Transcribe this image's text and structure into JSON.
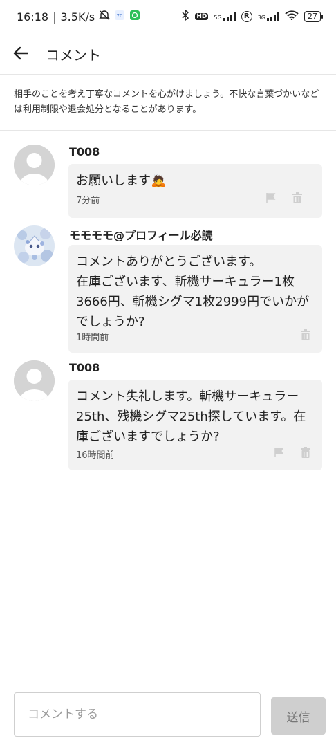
{
  "status_bar": {
    "time": "16:18",
    "network_speed": "3.5K/s",
    "network_type_1": "5G",
    "network_type_2": "3G",
    "battery": "27",
    "hd_label": "HD",
    "roaming_label": "R"
  },
  "header": {
    "title": "コメント",
    "back_icon": "arrow-left-icon"
  },
  "notice": {
    "text": "相手のことを考え丁寧なコメントを心がけましょう。不快な言葉づかいなどは利用制限や退会処分となることがあります。"
  },
  "comments": [
    {
      "user": "T008",
      "avatar": "default-avatar",
      "text": "お願いします🙇",
      "time": "7分前",
      "show_flag": true
    },
    {
      "user": "モモモモ@プロフィール必読",
      "avatar": "custom-avatar",
      "text": "コメントありがとうございます。\n在庫ございます、斬機サーキュラー1枚3666円、斬機シグマ1枚2999円でいかがでしょうか?",
      "time": "1時間前",
      "show_flag": false
    },
    {
      "user": "T008",
      "avatar": "default-avatar",
      "text": "コメント失礼します。斬機サーキュラー25th、残機シグマ25th探しています。在庫ございますでしょうか?",
      "time": "16時間前",
      "show_flag": true
    }
  ],
  "composer": {
    "placeholder": "コメントする",
    "send_label": "送信"
  },
  "colors": {
    "bubble_bg": "#f2f2f2",
    "send_button_bg": "#cfcfcf",
    "divider": "#e6e6e6"
  }
}
